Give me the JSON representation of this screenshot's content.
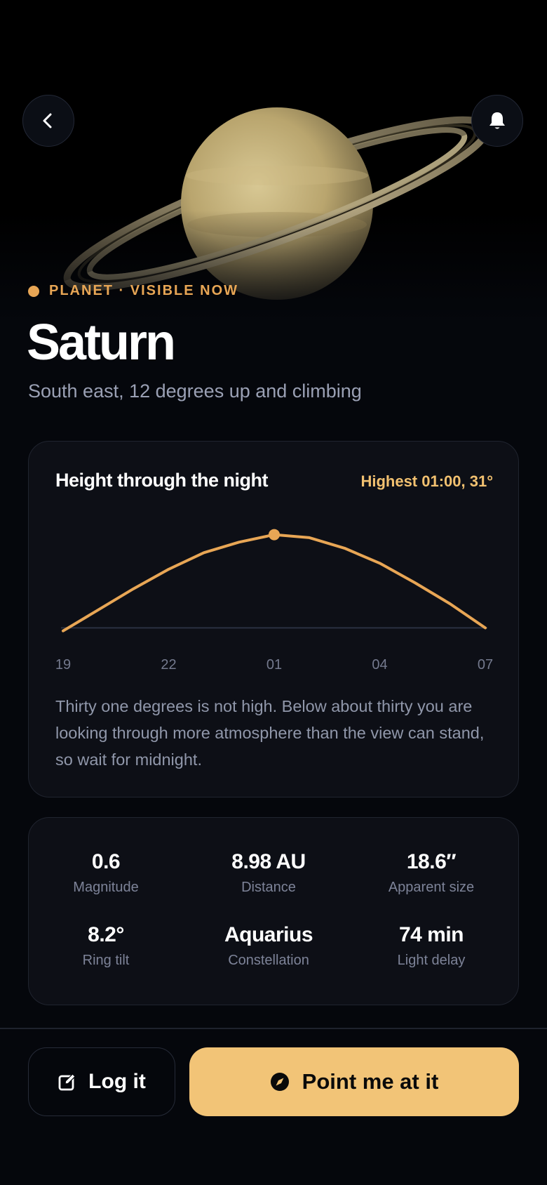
{
  "header": {
    "back_icon": "chevron-left-icon",
    "bell_icon": "bell-icon"
  },
  "object": {
    "category": "PLANET · VISIBLE NOW",
    "name": "Saturn",
    "position": "South east, 12 degrees up and climbing"
  },
  "chart_card": {
    "title": "Height through the night",
    "highlight": "Highest 01:00, 31°",
    "note": "Thirty one degrees is not high. Below about thirty you are looking through more atmosphere than the view can stand, so wait for midnight."
  },
  "chart_data": {
    "type": "line",
    "x": [
      19,
      20,
      21,
      22,
      23,
      24,
      25,
      26,
      27,
      28,
      29,
      30,
      31
    ],
    "x_tick_labels": [
      "19",
      "22",
      "01",
      "04",
      "07"
    ],
    "y": [
      -1,
      6,
      13,
      19.5,
      25,
      28.5,
      31,
      30,
      26.5,
      21.5,
      15,
      8,
      0
    ],
    "peak": {
      "x": 25,
      "y": 31
    },
    "ylim": [
      -2,
      33
    ],
    "horizon": 0,
    "color": "#e8a655",
    "title": "",
    "xlabel": "",
    "ylabel": ""
  },
  "stats": [
    {
      "value": "0.6",
      "label": "Magnitude"
    },
    {
      "value": "8.98 AU",
      "label": "Distance"
    },
    {
      "value": "18.6″",
      "label": "Apparent size"
    },
    {
      "value": "8.2°",
      "label": "Ring tilt"
    },
    {
      "value": "Aquarius",
      "label": "Constellation"
    },
    {
      "value": "74 min",
      "label": "Light delay"
    }
  ],
  "actions": {
    "log_label": "Log it",
    "log_icon": "edit-icon",
    "point_label": "Point me at it",
    "point_icon": "compass-icon"
  },
  "colors": {
    "accent": "#e8a655",
    "button": "#f2c477",
    "background": "#05070c"
  }
}
